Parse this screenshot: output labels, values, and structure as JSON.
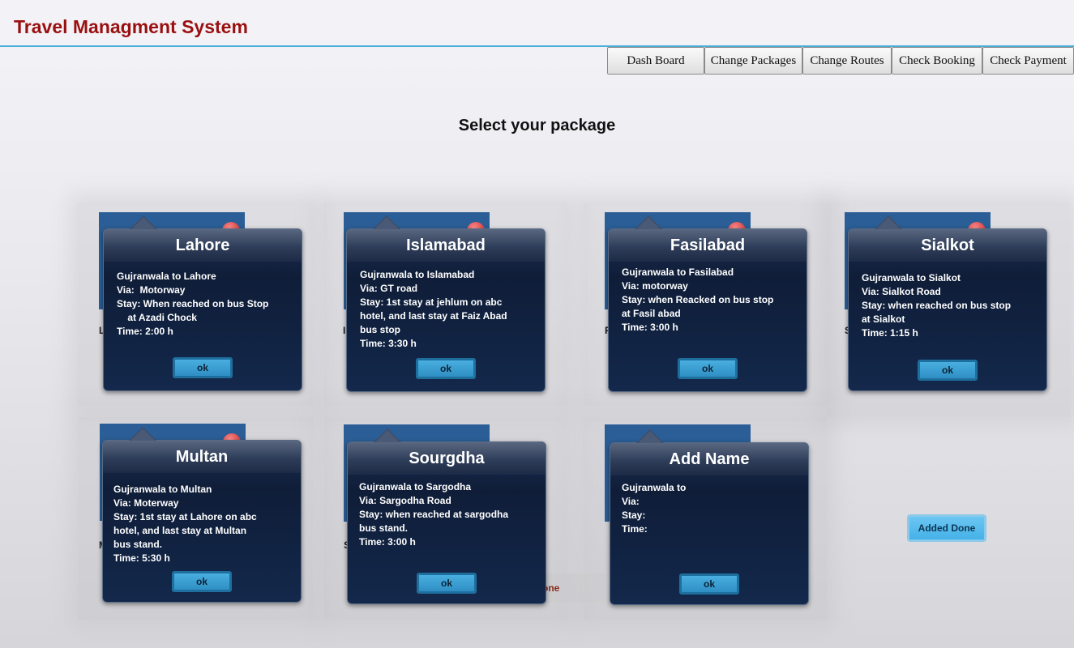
{
  "header": {
    "title": "Travel Managment System"
  },
  "nav": [
    {
      "label": "Dash Board"
    },
    {
      "label": "Change Packages"
    },
    {
      "label": "Change Routes"
    },
    {
      "label": "Check Booking"
    },
    {
      "label": "Check Payment"
    }
  ],
  "main": {
    "heading": "Select your package",
    "added_done_label": "Added Done",
    "done_ghost_label": "done"
  },
  "cards": [
    {
      "title": "Lahore",
      "lines": [
        "Gujranwala to Lahore",
        "Via:  Motorway",
        "Stay: When reached on bus Stop",
        "    at Azadi Chock",
        "Time: 2:00 h"
      ],
      "ok_label": "ok",
      "behind_label": "Lo"
    },
    {
      "title": "Islamabad",
      "lines": [
        "Gujranwala to Islamabad",
        "Via: GT road",
        "Stay: 1st stay at jehlum on abc",
        "hotel, and last stay at Faiz Abad",
        "bus stop",
        "Time: 3:30 h"
      ],
      "ok_label": "ok",
      "behind_label": "Is"
    },
    {
      "title": "Fasilabad",
      "lines": [
        "Gujranwala to Fasilabad",
        "Via: motorway",
        "Stay: when Reacked on bus stop",
        "at Fasil abad",
        "Time: 3:00 h"
      ],
      "ok_label": "ok",
      "behind_label": "F"
    },
    {
      "title": "Sialkot",
      "lines": [
        "Gujranwala to Sialkot",
        "Via: Sialkot Road",
        "Stay: when reached on bus stop",
        "at Sialkot",
        "Time: 1:15 h"
      ],
      "ok_label": "ok",
      "behind_label": "S"
    },
    {
      "title": "Multan",
      "lines": [
        "Gujranwala to Multan",
        "Via: Moterway",
        "Stay: 1st stay at Lahore on abc",
        "hotel, and last stay at Multan",
        "bus stand.",
        "Time: 5:30 h"
      ],
      "ok_label": "ok",
      "behind_label": "M"
    },
    {
      "title": "Sourgdha",
      "lines": [
        "Gujranwala to Sargodha",
        "Via: Sargodha Road",
        "Stay: when reached at sargodha",
        "bus stand.",
        "Time: 3:00 h"
      ],
      "ok_label": "ok",
      "behind_label": "S"
    },
    {
      "title": "Add Name",
      "lines": [
        "Gujranwala to",
        "Via:",
        "Stay:",
        "Time:"
      ],
      "ok_label": "ok",
      "behind_label": ""
    }
  ]
}
